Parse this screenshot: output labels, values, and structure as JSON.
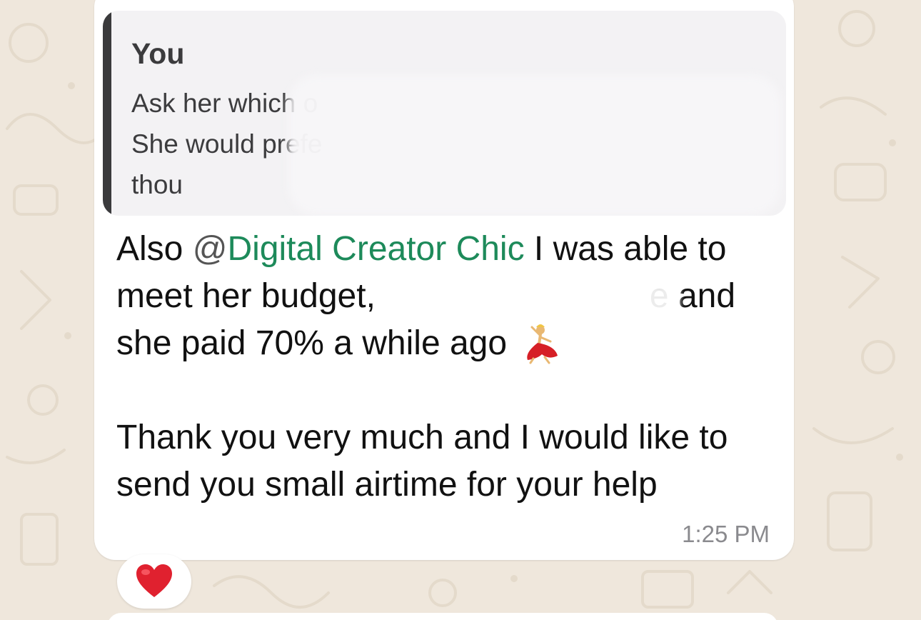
{
  "message": {
    "reply": {
      "author": "You",
      "lines": [
        "Ask her which o",
        "She would prefe",
        "thou"
      ]
    },
    "body": {
      "line1_prefix": "Also ",
      "mention_at": "@",
      "mention_name": "Digital Creator Chic",
      "line1_suffix": " I was able to",
      "line2_visible": "meet her budget,",
      "line2_end": "e and",
      "line3": "she paid 70% a while ago",
      "line4": "Thank you very much and I would like to",
      "line5": "send you small airtime for your help"
    },
    "timestamp": "1:25 PM",
    "reaction_icon": "red-heart-icon"
  },
  "colors": {
    "chat_background": "#efe7dc",
    "bubble": "#ffffff",
    "mention": "#1d8a5a",
    "quote_bar": "#3a3a3c",
    "reaction_heart": "#e0212f"
  }
}
